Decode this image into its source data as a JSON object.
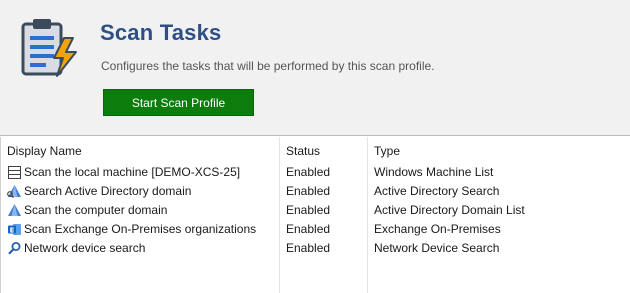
{
  "header": {
    "title": "Scan Tasks",
    "subtitle": "Configures the tasks that will be performed by this scan profile.",
    "start_button": "Start Scan Profile",
    "icon": "clipboard-lightning-icon"
  },
  "table": {
    "columns": [
      "Display Name",
      "Status",
      "Type"
    ],
    "rows": [
      {
        "name": "Scan the local machine [DEMO-XCS-25]",
        "status": "Enabled",
        "type": "Windows Machine List",
        "icon": "machine-list-icon"
      },
      {
        "name": "Search Active Directory domain",
        "status": "Enabled",
        "type": "Active Directory Search",
        "icon": "active-directory-search-icon"
      },
      {
        "name": "Scan the computer domain",
        "status": "Enabled",
        "type": "Active Directory Domain List",
        "icon": "active-directory-icon"
      },
      {
        "name": "Scan Exchange On-Premises organizations",
        "status": "Enabled",
        "type": "Exchange On-Premises",
        "icon": "exchange-icon"
      },
      {
        "name": "Network device search",
        "status": "Enabled",
        "type": "Network Device Search",
        "icon": "network-search-icon"
      }
    ]
  },
  "colors": {
    "title": "#2d4f86",
    "button": "#0c7c0c",
    "header_bg": "#f1f1f1"
  }
}
